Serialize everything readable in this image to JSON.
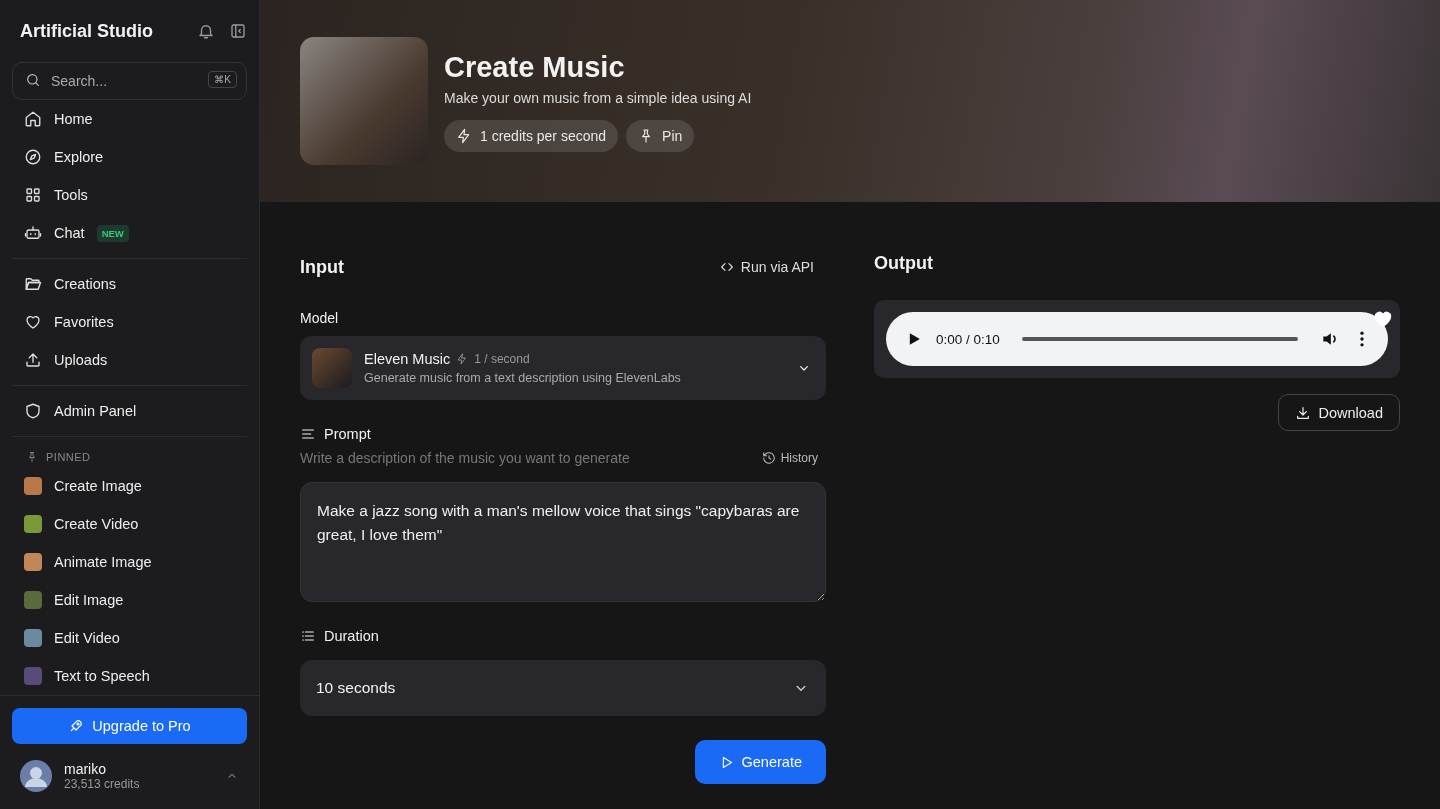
{
  "sidebar": {
    "brand": "Artificial Studio",
    "search": {
      "placeholder": "Search...",
      "shortcut": "⌘K"
    },
    "nav_groups": [
      [
        {
          "label": "Home"
        },
        {
          "label": "Explore"
        },
        {
          "label": "Tools"
        },
        {
          "label": "Chat",
          "badge": "NEW"
        }
      ],
      [
        {
          "label": "Creations"
        },
        {
          "label": "Favorites"
        },
        {
          "label": "Uploads"
        }
      ],
      [
        {
          "label": "Admin Panel"
        }
      ]
    ],
    "pinned_heading": "PINNED",
    "pinned": [
      {
        "label": "Create Image",
        "color": "#b8794a"
      },
      {
        "label": "Create Video",
        "color": "#7a9a3a"
      },
      {
        "label": "Animate Image",
        "color": "#c08858"
      },
      {
        "label": "Edit Image",
        "color": "#5a6a3a"
      },
      {
        "label": "Edit Video",
        "color": "#6a8aa0"
      },
      {
        "label": "Text to Speech",
        "color": "#5a4a7a"
      }
    ],
    "upgrade": "Upgrade to Pro",
    "user": {
      "name": "mariko",
      "credits": "23,513 credits"
    }
  },
  "header": {
    "title": "Create Music",
    "subtitle": "Make your own music from a simple idea using AI",
    "chips": [
      {
        "label": "1 credits per second"
      },
      {
        "label": "Pin"
      }
    ]
  },
  "input": {
    "heading": "Input",
    "api_link": "Run via API",
    "model": {
      "label": "Model",
      "name": "Eleven Music",
      "rate": "1 / second",
      "description": "Generate music from a text description using ElevenLabs"
    },
    "prompt": {
      "label": "Prompt",
      "hint": "Write a description of the music you want to generate",
      "history": "History",
      "value": "Make a jazz song with a man's mellow voice that sings \"capybaras are great, I love them\""
    },
    "duration": {
      "label": "Duration",
      "value": "10 seconds"
    },
    "generate": "Generate"
  },
  "output": {
    "heading": "Output",
    "player": {
      "time": "0:00 / 0:10"
    },
    "download": "Download"
  }
}
